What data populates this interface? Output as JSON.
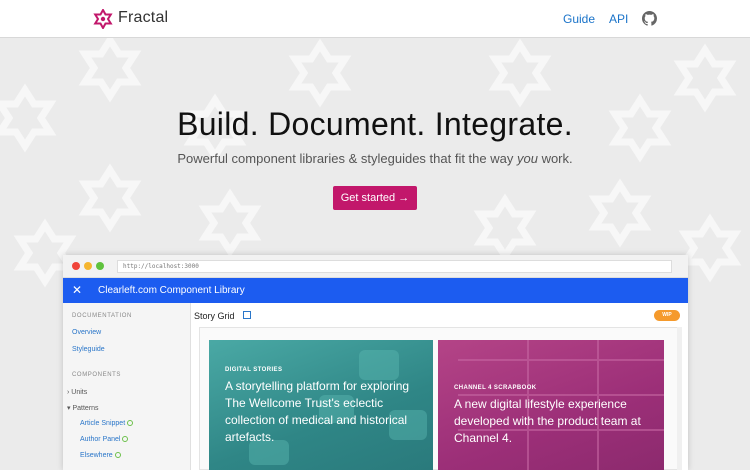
{
  "header": {
    "brand": "Fractal",
    "nav": [
      {
        "label": "Guide"
      },
      {
        "label": "API"
      }
    ],
    "github_icon": "github-icon"
  },
  "hero": {
    "title": "Build. Document. Integrate.",
    "subtitle_before": "Powerful component libraries & styleguides that fit the way ",
    "subtitle_em": "you",
    "subtitle_after": " work.",
    "cta_label": "Get started →"
  },
  "browser": {
    "url": "http://localhost:3000",
    "app_title": "Clearleft.com Component Library",
    "close_icon": "close-icon",
    "sidebar": {
      "documentation_heading": "DOCUMENTATION",
      "doc_links": [
        "Overview",
        "Styleguide"
      ],
      "components_heading": "COMPONENTS",
      "units": "Units",
      "patterns": "Patterns",
      "pattern_items": [
        "Article Snippet",
        "Author Panel",
        "Elsewhere"
      ]
    },
    "main": {
      "title": "Story Grid",
      "badge": "WIP"
    },
    "cards": [
      {
        "kicker": "DIGITAL STORIES",
        "body": "A storytelling platform for exploring The Wellcome Trust's eclectic collection of medical and historical artefacts."
      },
      {
        "kicker": "CHANNEL 4 SCRAPBOOK",
        "body": "A new digital lifestyle experience developed with the product team at Channel 4."
      }
    ]
  },
  "colors": {
    "brand": "#c2176b",
    "nav_link": "#1a73c9",
    "app_bar": "#1c5cf0",
    "wip_badge": "#f59a2c",
    "card_teal": "#3f9c9a",
    "card_magenta": "#a9357f"
  }
}
